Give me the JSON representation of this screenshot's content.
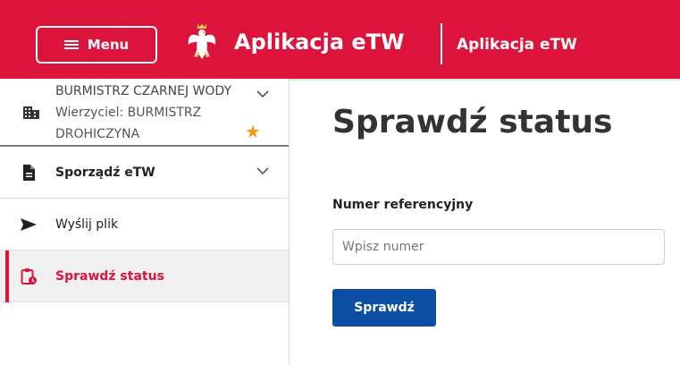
{
  "header": {
    "menu_label": "Menu",
    "app_title": "Aplikacja eTW",
    "app_subtitle": "Aplikacja eTW"
  },
  "sidebar": {
    "creditor": {
      "name": "BURMISTRZ CZARNEJ WODY",
      "line2": "Wierzyciel: BURMISTRZ",
      "line3": "DROHICZYNA"
    },
    "items": [
      {
        "label": "Sporządź eTW",
        "icon": "document-icon"
      },
      {
        "label": "Wyślij plik",
        "icon": "send-icon"
      },
      {
        "label": "Sprawdź status",
        "icon": "clipboard-clock-icon",
        "active": true
      }
    ]
  },
  "main": {
    "title": "Sprawdź status",
    "field_label": "Numer referencyjny",
    "input_placeholder": "Wpisz numer",
    "input_value": "",
    "submit_label": "Sprawdź"
  },
  "colors": {
    "header_bg": "#dc143c",
    "primary_button": "#0b4ea2",
    "active_accent": "#dc143c",
    "star": "#f39c12"
  }
}
